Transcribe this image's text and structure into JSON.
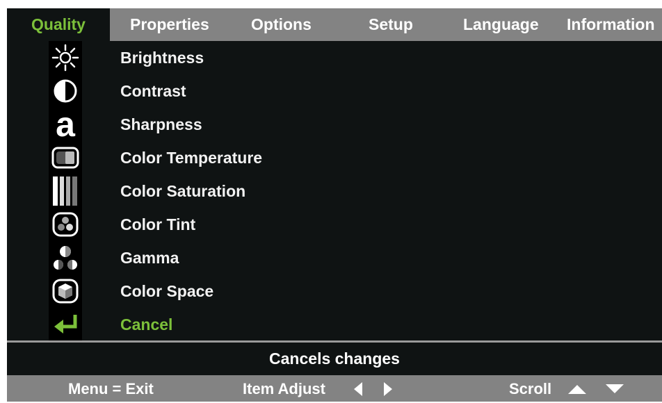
{
  "tabs": [
    {
      "label": "Quality",
      "active": true
    },
    {
      "label": "Properties",
      "active": false
    },
    {
      "label": "Options",
      "active": false
    },
    {
      "label": "Setup",
      "active": false
    },
    {
      "label": "Language",
      "active": false
    },
    {
      "label": "Information",
      "active": false
    }
  ],
  "menu": {
    "items": [
      {
        "label": "Brightness",
        "icon": "brightness-sun-icon"
      },
      {
        "label": "Contrast",
        "icon": "contrast-circle-icon"
      },
      {
        "label": "Sharpness",
        "icon": "sharpness-letter-a-icon"
      },
      {
        "label": "Color Temperature",
        "icon": "color-temperature-screen-icon"
      },
      {
        "label": "Color Saturation",
        "icon": "color-saturation-bars-icon"
      },
      {
        "label": "Color Tint",
        "icon": "color-tint-icon"
      },
      {
        "label": "Gamma",
        "icon": "gamma-dots-icon"
      },
      {
        "label": "Color Space",
        "icon": "color-space-cube-icon"
      },
      {
        "label": "Cancel",
        "icon": "return-arrow-icon",
        "highlight": true
      }
    ]
  },
  "help_text": "Cancels changes",
  "footer": {
    "menu_exit": "Menu = Exit",
    "item_adjust": "Item Adjust",
    "scroll": "Scroll"
  },
  "colors": {
    "accent_green": "#7cc03a",
    "background": "#0f1313",
    "bar_gray": "#838383"
  }
}
